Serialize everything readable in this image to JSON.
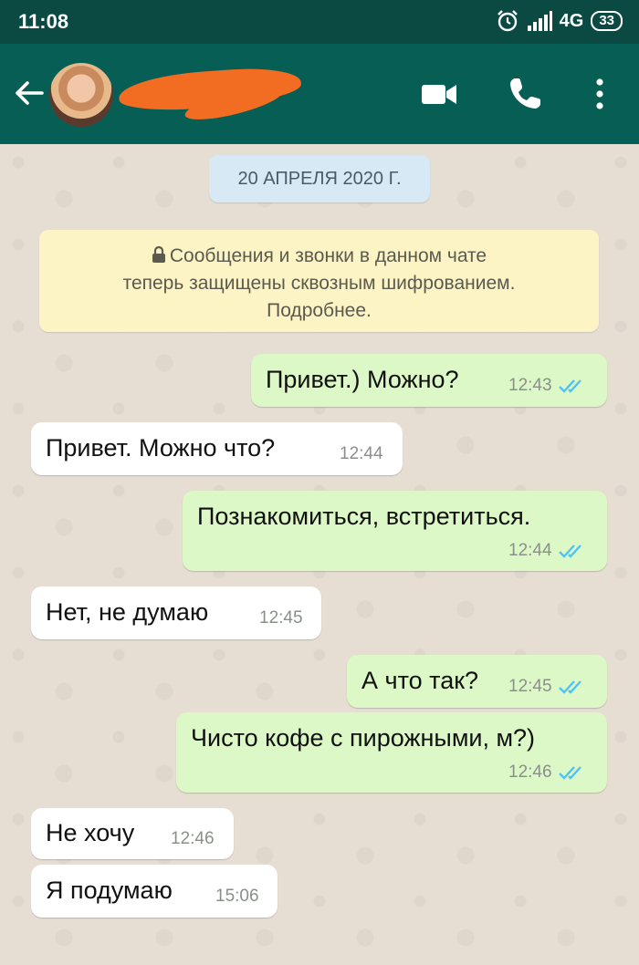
{
  "status_bar": {
    "time": "11:08",
    "network": "4G",
    "battery": "33"
  },
  "header": {
    "icons": [
      "back-arrow-icon",
      "video-call-icon",
      "phone-call-icon",
      "more-options-icon"
    ]
  },
  "chat": {
    "date_label": "20 АПРЕЛЯ 2020 Г.",
    "encryption_notice": {
      "line1": "Сообщения и звонки в данном чате",
      "line2": "теперь защищены сквозным шифрованием.",
      "line3": "Подробнее."
    },
    "messages": [
      {
        "direction": "out",
        "text": "Привет.) Можно?",
        "time": "12:43",
        "status": "read"
      },
      {
        "direction": "in",
        "text": "Привет. Можно что?",
        "time": "12:44"
      },
      {
        "direction": "out",
        "text": "Познакомиться, встретиться.",
        "time": "12:44",
        "status": "read"
      },
      {
        "direction": "in",
        "text": "Нет, не думаю",
        "time": "12:45"
      },
      {
        "direction": "out",
        "text": "А что так?",
        "time": "12:45",
        "status": "read"
      },
      {
        "direction": "out",
        "text": "Чисто кофе с пирожными, м?)",
        "time": "12:46",
        "status": "read"
      },
      {
        "direction": "in",
        "text": "Не хочу",
        "time": "12:46"
      },
      {
        "direction": "in",
        "text": "Я подумаю",
        "time": "15:06"
      }
    ]
  },
  "colors": {
    "header": "#075e54",
    "status_bar": "#0a4a42",
    "outgoing_bubble": "#dcf8c6",
    "incoming_bubble": "#ffffff",
    "read_ticks": "#4fc3f7"
  }
}
